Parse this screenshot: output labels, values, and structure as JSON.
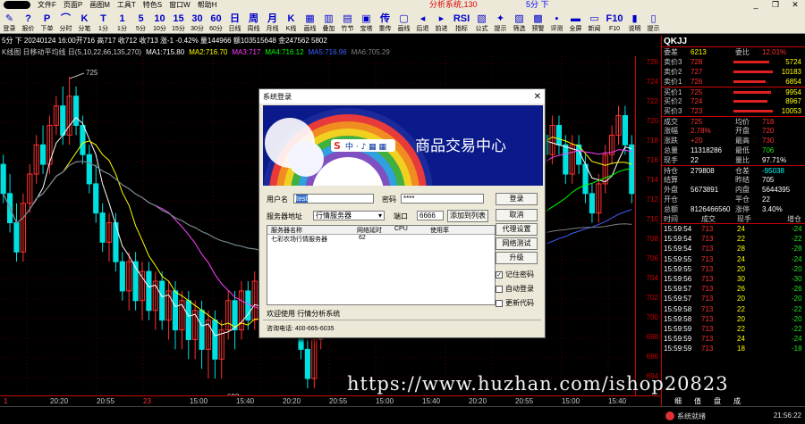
{
  "menubar": {
    "items": [
      "文件F",
      "页面P",
      "画图M",
      "工具T",
      "特色S",
      "窗口W",
      "帮助H"
    ],
    "title_partial": "分析系统,130",
    "period": "5分 下"
  },
  "toolbar": {
    "buttons": [
      {
        "icon": "✎",
        "label": "登录"
      },
      {
        "icon": "?",
        "label": "报价"
      },
      {
        "icon": "P",
        "label": "下单"
      },
      {
        "icon": "⌒",
        "label": "分时"
      },
      {
        "icon": "K",
        "label": "分笔"
      },
      {
        "icon": "T",
        "label": "1分"
      },
      {
        "icon": "1",
        "label": "1分"
      },
      {
        "icon": "5",
        "label": "5分"
      },
      {
        "icon": "10",
        "label": "10分"
      },
      {
        "icon": "15",
        "label": "15分"
      },
      {
        "icon": "30",
        "label": "30分"
      },
      {
        "icon": "60",
        "label": "60分"
      },
      {
        "icon": "日",
        "label": "日线"
      },
      {
        "icon": "周",
        "label": "周线"
      },
      {
        "icon": "月",
        "label": "月线"
      },
      {
        "icon": "K",
        "label": "K线"
      },
      {
        "icon": "▦",
        "label": "画线"
      },
      {
        "icon": "▥",
        "label": "叠加"
      },
      {
        "icon": "▤",
        "label": "竹节"
      },
      {
        "icon": "▣",
        "label": "宝塔"
      },
      {
        "icon": "传",
        "label": "重传"
      },
      {
        "icon": "▢",
        "label": "画线"
      },
      {
        "icon": "◂",
        "label": "后退"
      },
      {
        "icon": "▸",
        "label": "前进"
      },
      {
        "icon": "RSI",
        "label": "指标"
      },
      {
        "icon": "▧",
        "label": "公式"
      },
      {
        "icon": "✦",
        "label": "提示"
      },
      {
        "icon": "▨",
        "label": "筛选"
      },
      {
        "icon": "▩",
        "label": "预警"
      },
      {
        "icon": "▪",
        "label": "评测"
      },
      {
        "icon": "▬",
        "label": "全屏"
      },
      {
        "icon": "▭",
        "label": "新闻"
      },
      {
        "icon": "F10",
        "label": "F10"
      },
      {
        "icon": "▮",
        "label": "说明"
      },
      {
        "icon": "▯",
        "label": "提示"
      }
    ]
  },
  "chart_header": "K线图 日移动平均线 日(5,10,22,66,135,270) MA1:715.80 MA2:716.70 MA3:717 MA4:716.12 MA5:716.96 MA6:705.29",
  "top_info": "5分 下  20240124 16:00开716 高717 收712 收713 涨-1 -0.42% 量144966 额103515648 金247562 5802",
  "indicators": [
    {
      "text": "K线图 日移动平均线 日(5,10,22,66,135,270)",
      "color": "#cccccc"
    },
    {
      "text": "MA1:715.80",
      "color": "#ffffff"
    },
    {
      "text": "MA2:716.70",
      "color": "#ffff00"
    },
    {
      "text": "MA3:717",
      "color": "#ff40ff"
    },
    {
      "text": "MA4:716.12",
      "color": "#00ff00"
    },
    {
      "text": "MA5:716.96",
      "color": "#4060ff"
    },
    {
      "text": "MA6:705.29",
      "color": "#808080"
    }
  ],
  "chart_labels": {
    "high": "725",
    "low": "693"
  },
  "yaxis": [
    "726",
    "724",
    "722",
    "720",
    "718",
    "716",
    "714",
    "712",
    "710",
    "708",
    "706",
    "704",
    "702",
    "700",
    "698",
    "696",
    "694"
  ],
  "xaxis": [
    {
      "text": "1",
      "red": true
    },
    {
      "text": "20:20",
      "red": false
    },
    {
      "text": "20:55",
      "red": false
    },
    {
      "text": "23",
      "red": true
    },
    {
      "text": "15:00",
      "red": false
    },
    {
      "text": "15:40",
      "red": false
    },
    {
      "text": "20:20",
      "red": false
    },
    {
      "text": "20:55",
      "red": false
    },
    {
      "text": "15:00",
      "red": false
    },
    {
      "text": "15:40",
      "red": false
    },
    {
      "text": "20:20",
      "red": false
    },
    {
      "text": "20:55",
      "red": false
    },
    {
      "text": "15:00",
      "red": false
    },
    {
      "text": "15:40",
      "red": false
    }
  ],
  "right_panel": {
    "symbol": "QKJJ",
    "rows": [
      {
        "l": "委差",
        "v1": "6213",
        "c1": "yellow",
        "l2": "委比",
        "v2": "12.01%",
        "c2": "red"
      },
      {
        "l": "卖价3",
        "v1": "728",
        "c1": "red",
        "bar": 40,
        "vol": "5724"
      },
      {
        "l": "卖价2",
        "v1": "727",
        "c1": "red",
        "bar": 44,
        "vol": "10183"
      },
      {
        "l": "卖价1",
        "v1": "726",
        "c1": "red",
        "bar": 36,
        "vol": "6854"
      },
      {
        "sep": true,
        "l": "买价1",
        "v1": "725",
        "c1": "red",
        "bar": 42,
        "vol": "9954"
      },
      {
        "l": "买价2",
        "v1": "724",
        "c1": "red",
        "bar": 38,
        "vol": "8967"
      },
      {
        "l": "买价3",
        "v1": "723",
        "c1": "red",
        "bar": 44,
        "vol": "10053"
      },
      {
        "sep": true,
        "l": "成交",
        "v1": "725",
        "c1": "red",
        "l2": "均价",
        "v2": "718",
        "c2": "red"
      },
      {
        "l": "涨幅",
        "v1": "2.78%",
        "c1": "red",
        "l2": "开盘",
        "v2": "720",
        "c2": "red"
      },
      {
        "l": "涨跌",
        "v1": "+20",
        "c1": "red",
        "l2": "最高",
        "v2": "730",
        "c2": "red"
      },
      {
        "l": "总量",
        "v1": "11318286",
        "c1": "white",
        "l2": "最低",
        "v2": "706",
        "c2": "green"
      },
      {
        "l": "现手",
        "v1": "22",
        "c1": "white",
        "l2": "量比",
        "v2": "97.71%",
        "c2": "white"
      },
      {
        "sep": true,
        "l": "持仓",
        "v1": "279808",
        "c1": "white",
        "l2": "仓差",
        "v2": "-95038",
        "c2": "cyan"
      },
      {
        "l": "结算",
        "v1": "",
        "c1": "white",
        "l2": "昨结",
        "v2": "705",
        "c2": "white"
      },
      {
        "l": "外盘",
        "v1": "5673891",
        "c1": "white",
        "l2": "内盘",
        "v2": "5644395",
        "c2": "white"
      },
      {
        "l": "开仓",
        "v1": "",
        "c1": "white",
        "l2": "平仓",
        "v2": "22",
        "c2": "white"
      },
      {
        "l": "总额",
        "v1": "8126466560",
        "c1": "white",
        "l2": "涨停",
        "v2": "3.40%",
        "c2": "white"
      }
    ],
    "tick_headers": [
      "时间",
      "成交",
      "现手",
      "增仓"
    ],
    "ticks": [
      {
        "t": "15:59:54",
        "p": "713",
        "v": "24",
        "d": "-24"
      },
      {
        "t": "15:59:54",
        "p": "713",
        "v": "22",
        "d": "-22"
      },
      {
        "t": "15:59:54",
        "p": "713",
        "v": "28",
        "d": "-28"
      },
      {
        "t": "15:59:55",
        "p": "713",
        "v": "24",
        "d": "-24"
      },
      {
        "t": "15:59:55",
        "p": "713",
        "v": "20",
        "d": "-20"
      },
      {
        "t": "15:59:56",
        "p": "713",
        "v": "30",
        "d": "-30"
      },
      {
        "t": "15:59:57",
        "p": "713",
        "v": "26",
        "d": "-26"
      },
      {
        "t": "15:59:57",
        "p": "713",
        "v": "20",
        "d": "-20"
      },
      {
        "t": "15:59:58",
        "p": "713",
        "v": "22",
        "d": "-22"
      },
      {
        "t": "15:59:58",
        "p": "713",
        "v": "20",
        "d": "-20"
      },
      {
        "t": "15:59:59",
        "p": "713",
        "v": "22",
        "d": "-22"
      },
      {
        "t": "15:59:59",
        "p": "713",
        "v": "24",
        "d": "-24"
      },
      {
        "t": "15:59:59",
        "p": "713",
        "v": "18",
        "d": "-18"
      }
    ],
    "tabs": [
      "细",
      "值",
      "盘",
      "成"
    ]
  },
  "dialog": {
    "title": "系统登录",
    "banner_text": "商品交易中心",
    "user_label": "用户名",
    "user_value": "test",
    "pwd_label": "密码",
    "pwd_value": "****",
    "server_label": "服务器地址",
    "server_value": "行情服务器",
    "port_label": "端口",
    "port_value": "6666",
    "add_btn": "添加到列表",
    "list_headers": [
      "服务器名称",
      "网络延时",
      "CPU",
      "使用率"
    ],
    "list_rows": [
      {
        "name": "七彩农场行情服务器",
        "latency": "62"
      }
    ],
    "buttons": [
      "登录",
      "取消",
      "代理设置",
      "网络测试",
      "升级"
    ],
    "checkboxes": [
      {
        "label": "记住密码",
        "checked": true
      },
      {
        "label": "自动登录",
        "checked": false
      },
      {
        "label": "更新代码",
        "checked": false
      }
    ],
    "welcome": "欢迎使用        行情分析系统",
    "tel": "咨询电话: 400-665-6035"
  },
  "watermark": "https://www.huzhan.com/ishop20823",
  "status": {
    "text": "系统就绪",
    "clock": "21:56:22"
  },
  "chart_data": {
    "type": "candlestick",
    "ylim": [
      693,
      726
    ],
    "high_label": 725,
    "low_label": 693,
    "candles": [
      [
        716,
        713,
        717,
        712
      ],
      [
        713,
        710,
        715,
        709
      ],
      [
        710,
        707,
        712,
        706
      ],
      [
        707,
        712,
        713,
        706
      ],
      [
        712,
        715,
        716,
        711
      ],
      [
        715,
        718,
        719,
        714
      ],
      [
        718,
        716,
        720,
        715
      ],
      [
        716,
        720,
        721,
        715
      ],
      [
        720,
        722,
        723,
        719
      ],
      [
        722,
        719,
        724,
        718
      ],
      [
        719,
        723,
        725,
        718
      ],
      [
        723,
        720,
        724,
        719
      ],
      [
        720,
        717,
        721,
        716
      ],
      [
        717,
        714,
        718,
        713
      ],
      [
        714,
        711,
        716,
        710
      ],
      [
        711,
        708,
        712,
        707
      ],
      [
        708,
        710,
        711,
        706
      ],
      [
        710,
        706,
        711,
        705
      ],
      [
        706,
        703,
        707,
        702
      ],
      [
        703,
        706,
        707,
        701
      ],
      [
        706,
        702,
        707,
        701
      ],
      [
        702,
        705,
        706,
        700
      ],
      [
        705,
        701,
        706,
        700
      ],
      [
        701,
        704,
        705,
        699
      ],
      [
        704,
        700,
        705,
        699
      ],
      [
        700,
        703,
        704,
        698
      ],
      [
        703,
        699,
        704,
        697
      ],
      [
        699,
        702,
        703,
        697
      ],
      [
        702,
        698,
        703,
        696
      ],
      [
        698,
        701,
        702,
        696
      ],
      [
        701,
        697,
        702,
        695
      ],
      [
        697,
        700,
        701,
        694
      ],
      [
        700,
        696,
        701,
        694
      ],
      [
        696,
        699,
        700,
        694
      ],
      [
        699,
        702,
        703,
        698
      ],
      [
        702,
        699,
        703,
        697
      ],
      [
        699,
        703,
        704,
        698
      ],
      [
        703,
        700,
        704,
        699
      ],
      [
        700,
        704,
        705,
        699
      ],
      [
        704,
        701,
        705,
        700
      ],
      [
        701,
        705,
        706,
        700
      ],
      [
        705,
        702,
        706,
        701
      ],
      [
        702,
        706,
        707,
        701
      ],
      [
        706,
        703,
        707,
        702
      ],
      [
        703,
        700,
        704,
        699
      ],
      [
        700,
        697,
        701,
        696
      ],
      [
        697,
        694,
        698,
        693
      ],
      [
        694,
        698,
        699,
        693
      ],
      [
        698,
        701,
        702,
        697
      ],
      [
        701,
        704,
        705,
        700
      ],
      [
        704,
        702,
        705,
        701
      ],
      [
        702,
        706,
        707,
        701
      ],
      [
        706,
        709,
        710,
        705
      ],
      [
        709,
        706,
        710,
        705
      ],
      [
        706,
        710,
        711,
        705
      ],
      [
        710,
        707,
        711,
        706
      ],
      [
        707,
        711,
        712,
        706
      ],
      [
        711,
        708,
        712,
        707
      ],
      [
        708,
        712,
        713,
        707
      ],
      [
        712,
        709,
        713,
        708
      ],
      [
        709,
        713,
        714,
        708
      ],
      [
        713,
        710,
        714,
        709
      ],
      [
        710,
        714,
        715,
        709
      ],
      [
        714,
        711,
        715,
        710
      ],
      [
        711,
        715,
        716,
        710
      ],
      [
        715,
        712,
        716,
        711
      ],
      [
        712,
        716,
        717,
        711
      ],
      [
        716,
        713,
        717,
        712
      ],
      [
        713,
        717,
        718,
        712
      ],
      [
        717,
        714,
        718,
        713
      ],
      [
        714,
        718,
        719,
        713
      ],
      [
        718,
        715,
        719,
        714
      ],
      [
        715,
        719,
        720,
        714
      ],
      [
        719,
        716,
        720,
        715
      ],
      [
        716,
        720,
        721,
        715
      ],
      [
        720,
        717,
        721,
        716
      ],
      [
        717,
        721,
        722,
        716
      ],
      [
        721,
        718,
        722,
        717
      ],
      [
        718,
        721,
        722,
        717
      ],
      [
        721,
        719,
        722,
        718
      ],
      [
        719,
        716,
        720,
        715
      ],
      [
        716,
        719,
        720,
        715
      ],
      [
        719,
        717,
        720,
        716
      ],
      [
        717,
        720,
        721,
        716
      ],
      [
        720,
        718,
        721,
        717
      ],
      [
        718,
        715,
        719,
        714
      ],
      [
        715,
        718,
        719,
        714
      ],
      [
        718,
        716,
        719,
        715
      ],
      [
        716,
        713,
        717,
        712
      ],
      [
        713,
        711,
        714,
        710
      ],
      [
        711,
        714,
        715,
        710
      ],
      [
        714,
        717,
        718,
        713
      ],
      [
        717,
        719,
        720,
        716
      ],
      [
        719,
        721,
        722,
        718
      ],
      [
        721,
        718,
        722,
        717
      ],
      [
        718,
        713,
        719,
        712
      ]
    ]
  }
}
